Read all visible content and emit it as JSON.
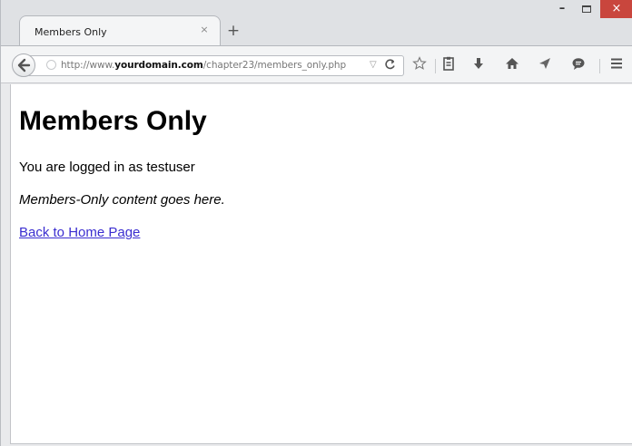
{
  "browser": {
    "tab": {
      "title": "Members Only",
      "close_glyph": "×"
    },
    "new_tab_glyph": "+",
    "window_controls": {
      "minimize_glyph": "–",
      "close_glyph": "×",
      "close_color": "#c9463d"
    },
    "address_bar": {
      "url_prefix": "http://www.",
      "url_domain": "yourdomain.com",
      "url_path": "/chapter23/members_only.php",
      "dropdown_glyph": "▽",
      "reload_glyph": "C"
    },
    "toolbar_icons": [
      "back-arrow-icon",
      "star-icon",
      "reading-list-icon",
      "download-icon",
      "home-icon",
      "share-icon",
      "chat-icon",
      "menu-icon"
    ]
  },
  "page": {
    "heading": "Members Only",
    "status": "You are logged in as testuser",
    "members_content": "Members-Only content goes here.",
    "home_link": "Back to Home Page",
    "link_color": "#3b2ed0"
  }
}
